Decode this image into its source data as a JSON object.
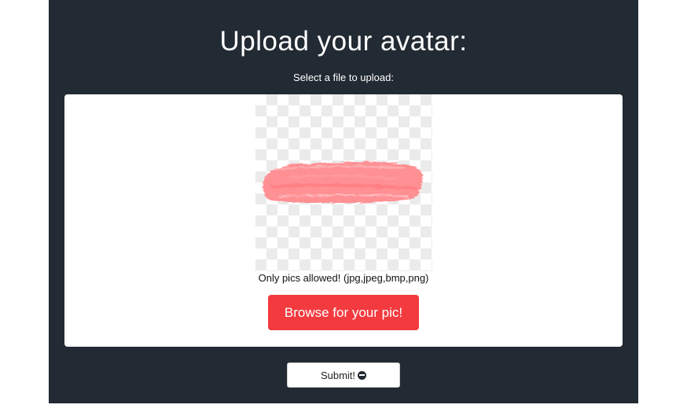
{
  "page": {
    "title": "Upload your avatar:",
    "subtitle": "Select a file to upload:"
  },
  "upload_card": {
    "preview_alt": "avatar preview",
    "allowed_note": "Only pics allowed! (jpg,jpeg,bmp,png)",
    "browse_label": "Browse for your pic!"
  },
  "form": {
    "submit_label": "Submit!",
    "submit_icon": "minus-circle-icon"
  },
  "colors": {
    "panel_bg": "#222a33",
    "accent": "#f23a3f",
    "brush_stroke": "#ff8a8e"
  }
}
